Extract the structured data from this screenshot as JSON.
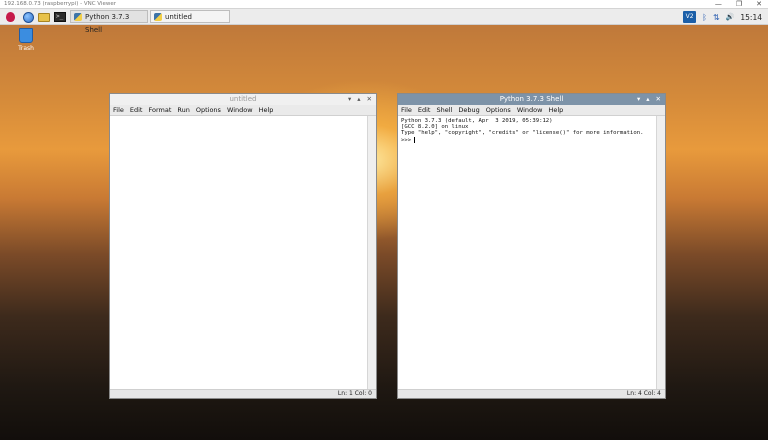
{
  "vnc": {
    "title": "192.168.0.73 (raspberrypi) - VNC Viewer",
    "controls": [
      "—",
      "❐",
      "✕"
    ]
  },
  "taskbar": {
    "launchers": [
      {
        "icon": "raspberry-icon"
      },
      {
        "icon": "browser-globe-icon"
      },
      {
        "icon": "file-manager-icon"
      },
      {
        "icon": "terminal-icon"
      }
    ],
    "tasks": [
      {
        "label": "Python 3.7.3 Shell"
      },
      {
        "label": "untitled"
      }
    ],
    "tray": {
      "vnc_icon": "vnc-icon",
      "bluetooth": "ᛒ",
      "network": "⇅",
      "volume": "🔊",
      "clock": "15:14"
    }
  },
  "desktop": {
    "trash_label": "Trash"
  },
  "editor_window": {
    "title": "untitled",
    "buttons": [
      "▾",
      "▴",
      "✕"
    ],
    "menu": [
      "File",
      "Edit",
      "Format",
      "Run",
      "Options",
      "Window",
      "Help"
    ],
    "status": "Ln: 1   Col: 0"
  },
  "shell_window": {
    "title": "Python 3.7.3 Shell",
    "buttons": [
      "▾",
      "▴",
      "✕"
    ],
    "menu": [
      "File",
      "Edit",
      "Shell",
      "Debug",
      "Options",
      "Window",
      "Help"
    ],
    "lines": [
      "Python 3.7.3 (default, Apr  3 2019, 05:39:12)",
      "[GCC 8.2.0] on linux",
      "Type \"help\", \"copyright\", \"credits\" or \"license()\" for more information.",
      ">>> "
    ],
    "status": "Ln: 4   Col: 4"
  }
}
